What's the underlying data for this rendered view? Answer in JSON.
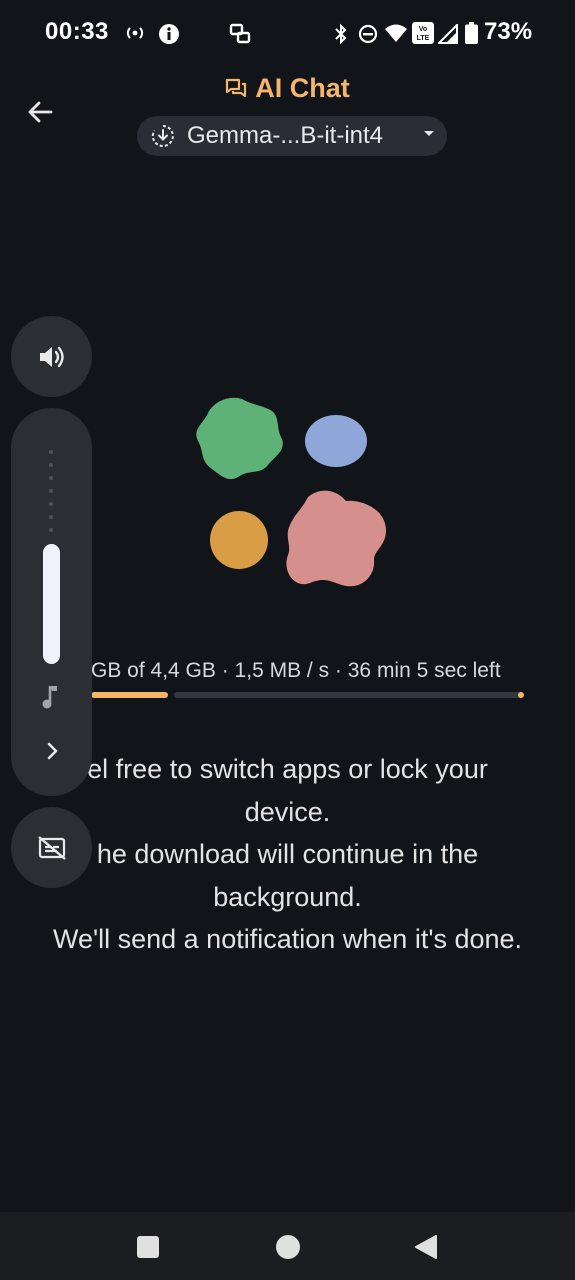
{
  "status_bar": {
    "time": "00:33",
    "battery_percent": "73%",
    "icons": [
      "hotspot-icon",
      "info-icon",
      "screen-share-icon",
      "bluetooth-icon",
      "do-not-disturb-icon",
      "wifi-icon",
      "volte-icon",
      "signal-icon",
      "battery-icon"
    ]
  },
  "app_bar": {
    "title": "AI Chat",
    "title_color": "#f3b66a",
    "model_name": "Gemma-...B-it-int4"
  },
  "download": {
    "progress_text": "GB of 4,4 GB · 1,5 MB / s · 36 min 5 sec left",
    "progress_fraction": 0.2,
    "accent_color": "#f5b565"
  },
  "message": {
    "line1": "el free to switch apps or lock your",
    "line2": "device.",
    "line3": "he download will continue in the",
    "line4": "background.",
    "line5": "We'll send a notification when it's done."
  },
  "volume_panel": {
    "level_fraction": 0.55
  },
  "blob_colors": {
    "green": "#5fb277",
    "blue": "#8fa6d9",
    "orange": "#d99d45",
    "pink": "#d58f8c"
  }
}
